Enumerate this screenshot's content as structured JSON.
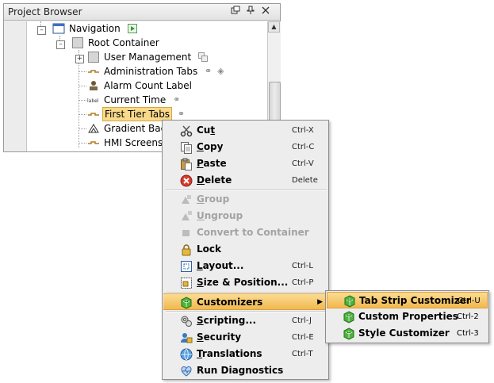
{
  "panel": {
    "title": "Project Browser",
    "tree": [
      {
        "label": "Navigation",
        "icon": "window-icon"
      },
      {
        "label": "Root Container",
        "icon": "container-icon"
      },
      {
        "label": "User Management",
        "icon": "container-icon"
      },
      {
        "label": "Administration Tabs",
        "icon": "tab-strip-icon"
      },
      {
        "label": "Alarm Count Label",
        "icon": "stamp-icon"
      },
      {
        "label": "Current Time",
        "icon": "label-icon"
      },
      {
        "label": "First Tier Tabs",
        "icon": "tab-strip-icon",
        "selected": true
      },
      {
        "label": "Gradient Back",
        "icon": "triangle-icon"
      },
      {
        "label": "HMI Screens T",
        "icon": "tab-strip-icon"
      }
    ]
  },
  "context_menu": {
    "items": [
      {
        "pre": "Cu",
        "u": "t",
        "post": "",
        "key": "Ctrl-X",
        "icon": "scissors-icon"
      },
      {
        "pre": "",
        "u": "C",
        "post": "opy",
        "key": "Ctrl-C",
        "icon": "copy-icon"
      },
      {
        "pre": "",
        "u": "P",
        "post": "aste",
        "key": "Ctrl-V",
        "icon": "paste-icon"
      },
      {
        "pre": "",
        "u": "D",
        "post": "elete",
        "key": "Delete",
        "icon": "delete-icon"
      },
      {
        "pre": "",
        "u": "G",
        "post": "roup",
        "key": "",
        "icon": "group-icon",
        "disabled": true
      },
      {
        "pre": "",
        "u": "U",
        "post": "ngroup",
        "key": "",
        "icon": "ungroup-icon",
        "disabled": true
      },
      {
        "pre": "Convert to Container",
        "u": "",
        "post": "",
        "key": "",
        "icon": "convert-icon",
        "disabled": true
      },
      {
        "pre": "Lock",
        "u": "",
        "post": "",
        "key": "",
        "icon": "lock-icon"
      },
      {
        "pre": "",
        "u": "L",
        "post": "ayout...",
        "key": "Ctrl-L",
        "icon": "layout-icon"
      },
      {
        "pre": "",
        "u": "S",
        "post": "ize & Position...",
        "key": "Ctrl-P",
        "icon": "size-position-icon"
      },
      {
        "pre": "Customizers",
        "u": "",
        "post": "",
        "key": "",
        "icon": "customizer-icon",
        "submenu": true
      },
      {
        "pre": "",
        "u": "S",
        "post": "cripting...",
        "key": "Ctrl-J",
        "icon": "scripting-icon"
      },
      {
        "pre": "",
        "u": "S",
        "post": "ecurity",
        "key": "Ctrl-E",
        "icon": "security-icon"
      },
      {
        "pre": "",
        "u": "T",
        "post": "ranslations",
        "key": "Ctrl-T",
        "icon": "translations-icon"
      },
      {
        "pre": "Run Diagnostics",
        "u": "",
        "post": "",
        "key": "",
        "icon": "diagnostics-icon"
      }
    ]
  },
  "submenu": {
    "items": [
      {
        "label": "Tab Strip Customizer",
        "key": "Ctrl-U",
        "icon": "customizer-icon"
      },
      {
        "label": "Custom Properties",
        "key": "Ctrl-2",
        "icon": "customizer-icon"
      },
      {
        "label": "Style Customizer",
        "key": "Ctrl-3",
        "icon": "customizer-icon"
      }
    ]
  },
  "colors": {
    "highlight": "#f1b84e",
    "menu_bg": "#ededed",
    "disabled_text": "#a3a3a3"
  }
}
